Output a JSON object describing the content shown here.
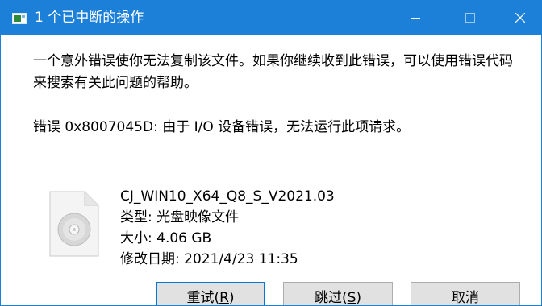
{
  "window": {
    "title": "1 个已中断的操作",
    "controls": {
      "minimize": "minimize",
      "maximize": "maximize",
      "close": "close"
    }
  },
  "message": "一个意外错误使你无法复制该文件。如果你继续收到此错误，可以使用错误代码来搜索有关此问题的帮助。",
  "error_line": "错误 0x8007045D: 由于 I/O 设备错误，无法运行此项请求。",
  "file": {
    "name": "CJ_WIN10_X64_Q8_S_V2021.03",
    "type": "类型: 光盘映像文件",
    "size": "大小: 4.06 GB",
    "modified": "修改日期: 2021/4/23 11:35",
    "icon": "disc-image-file-icon"
  },
  "buttons": {
    "retry": {
      "text": "重试(",
      "key": "R",
      "end": ")"
    },
    "skip": {
      "text": "跳过(",
      "key": "S",
      "end": ")"
    },
    "cancel": {
      "text": "取消"
    }
  },
  "colors": {
    "titlebar": "#1c7fd8",
    "button_bg": "#e1e1e1",
    "focus_border": "#0078d7"
  }
}
